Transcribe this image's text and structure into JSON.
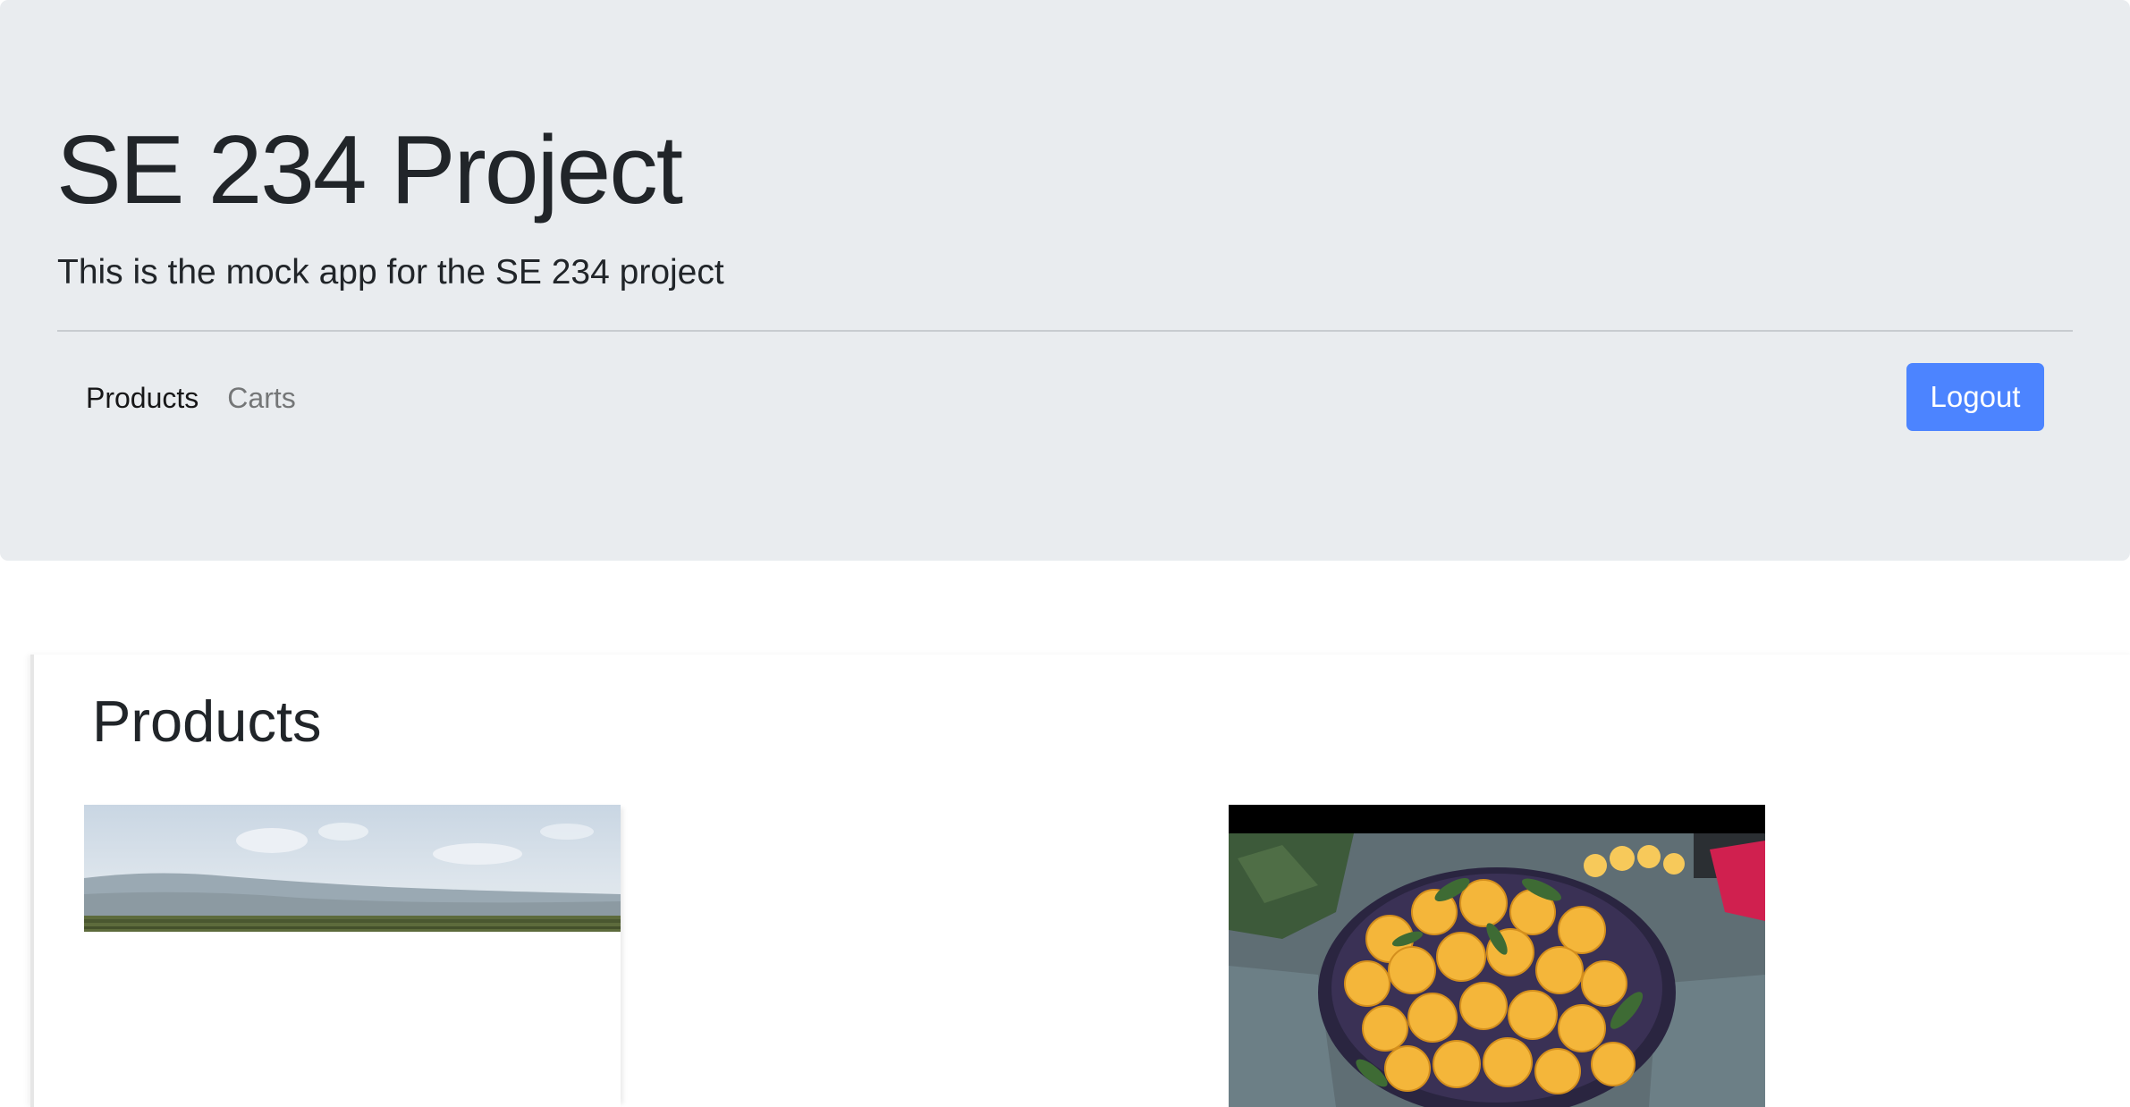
{
  "header": {
    "title": "SE 234 Project",
    "lead": "This is the mock app for the SE 234 project"
  },
  "nav": {
    "items": [
      {
        "label": "Products",
        "active": true
      },
      {
        "label": "Carts",
        "active": false
      }
    ],
    "logout_label": "Logout"
  },
  "colors": {
    "jumbotron_background": "#e9ecef",
    "primary_button": "#4c84ff",
    "text": "#212529"
  },
  "main": {
    "section_title": "Products",
    "products": [
      {
        "image_description": "landscape-field"
      },
      {
        "image_description": "basket-of-oranges"
      }
    ]
  }
}
